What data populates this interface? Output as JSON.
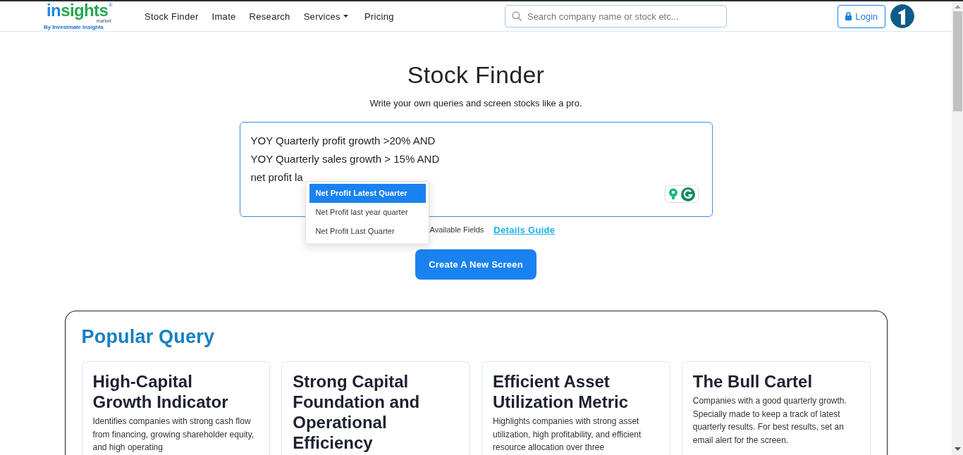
{
  "header": {
    "logo": {
      "wordmark": [
        "in",
        "sights"
      ],
      "registered": "®",
      "sub": "market",
      "tagline": "By Investmate Insights"
    },
    "nav": [
      {
        "label": "Stock Finder",
        "kind": "link"
      },
      {
        "label": "Imate",
        "kind": "link"
      },
      {
        "label": "Research",
        "kind": "link"
      },
      {
        "label": "Services",
        "kind": "dropdown"
      },
      {
        "label": "Pricing",
        "kind": "link"
      }
    ],
    "search": {
      "placeholder": "Search company name or stock etc..."
    },
    "login": {
      "label": "Login"
    }
  },
  "hero": {
    "title": "Stock Finder",
    "subtitle": "Write your own queries and screen stocks like a pro."
  },
  "query_editor": {
    "value": "YOY Quarterly profit growth >20% AND\nYOY Quarterly sales growth > 15% AND\nnet profit la",
    "suggestions": [
      {
        "label": "Net Profit Latest Quarter",
        "selected": true
      },
      {
        "label": "Net Profit last year quarter",
        "selected": false
      },
      {
        "label": "Net Profit Last Quarter",
        "selected": false
      }
    ]
  },
  "links_row": {
    "available_fields": "Available Fields",
    "details_guide": "Details Guide"
  },
  "create_button": {
    "label": "Create A New Screen"
  },
  "popular_query": {
    "title": "Popular Query",
    "cards": [
      {
        "title": "High-Capital Growth Indicator",
        "description": "Identifies companies with strong cash flow from financing, growing shareholder equity, and high operating"
      },
      {
        "title": "Strong Capital Foundation and Operational Efficiency"
      },
      {
        "title": "Efficient Asset Utilization Metric",
        "description": "Highlights companies with strong asset utilization, high profitability, and efficient resource allocation over three"
      },
      {
        "title": "The Bull Cartel",
        "description": "Companies with a good quarterly growth. Specially made to keep a track of latest quarterly results. For best results, set an email alert for the screen."
      }
    ]
  }
}
